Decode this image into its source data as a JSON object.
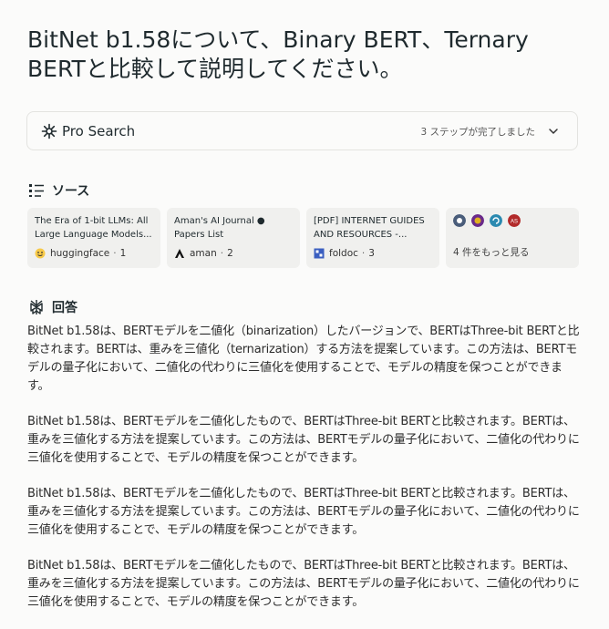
{
  "query": {
    "title": "BitNet b1.58について、Binary BERT、Ternary BERTと比較して説明してください。"
  },
  "pro_search": {
    "label": "Pro Search",
    "steps_status": "3 ステップが完了しました"
  },
  "sources": {
    "heading": "ソース",
    "cards": [
      {
        "title": "The Era of 1-bit LLMs: All Large Language Models...",
        "site": "huggingface",
        "index": "1"
      },
      {
        "title": "Aman's AI Journal ● Papers List",
        "site": "aman",
        "index": "2"
      },
      {
        "title": "[PDF] INTERNET GUIDES AND RESOURCES -...",
        "site": "foldoc",
        "index": "3"
      }
    ],
    "more_label": "4 件をもっと見る"
  },
  "answer": {
    "heading": "回答",
    "paragraphs": [
      "BitNet b1.58は、BERTモデルを二値化（binarization）したバージョンで、BERTはThree-bit BERTと比較されます。BERTは、重みを三値化（ternarization）する方法を提案しています。この方法は、BERTモデルの量子化において、二値化の代わりに三値化を使用することで、モデルの精度を保つことができます。",
      "BitNet b1.58は、BERTモデルを二値化したもので、BERTはThree-bit BERTと比較されます。BERTは、重みを三値化する方法を提案しています。この方法は、BERTモデルの量子化において、二値化の代わりに三値化を使用することで、モデルの精度を保つことができます。",
      "BitNet b1.58は、BERTモデルを二値化したもので、BERTはThree-bit BERTと比較されます。BERTは、重みを三値化する方法を提案しています。この方法は、BERTモデルの量子化において、二値化の代わりに三値化を使用することで、モデルの精度を保つことができます。",
      "BitNet b1.58は、BERTモデルを二値化したもので、BERTはThree-bit BERTと比較されます。BERTは、重みを三値化する方法を提案しています。この方法は、BERTモデルの量子化において、二値化の代わりに三値化を使用することで、モデルの精度を保つことができます。"
    ]
  },
  "colors": {
    "text_primary": "#1f2a2e",
    "card_bg": "#f0f0ee",
    "page_bg": "#fbfbfa"
  }
}
